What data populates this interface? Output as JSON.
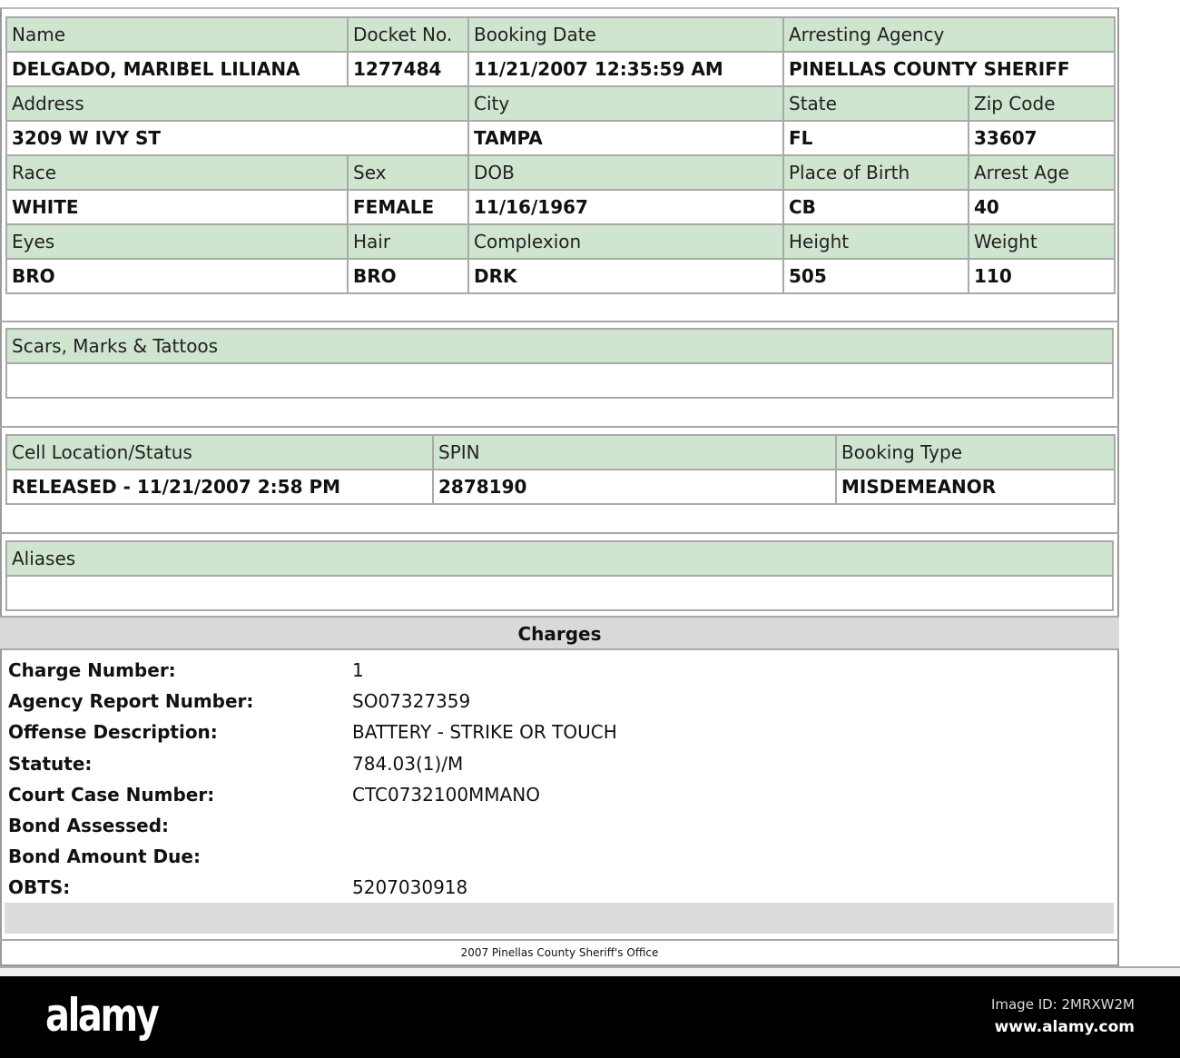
{
  "booking": {
    "rows": [
      {
        "headers": [
          "Name",
          "Docket No.",
          "Booking Date",
          "Arresting Agency"
        ],
        "values": [
          "DELGADO, MARIBEL LILIANA",
          "1277484",
          "11/21/2007 12:35:59 AM",
          "PINELLAS COUNTY SHERIFF"
        ]
      },
      {
        "headers": [
          "Address",
          "City",
          "State",
          "Zip Code"
        ],
        "values": [
          "3209 W IVY ST",
          "TAMPA",
          "FL",
          "33607"
        ]
      },
      {
        "headers": [
          "Race",
          "Sex",
          "DOB",
          "Place of Birth",
          "Arrest Age"
        ],
        "values": [
          "WHITE",
          "FEMALE",
          "11/16/1967",
          "CB",
          "40"
        ]
      },
      {
        "headers": [
          "Eyes",
          "Hair",
          "Complexion",
          "Height",
          "Weight"
        ],
        "values": [
          "BRO",
          "BRO",
          "DRK",
          "505",
          "110"
        ]
      }
    ]
  },
  "scars": {
    "header": "Scars, Marks & Tattoos",
    "value": ""
  },
  "cell": {
    "headers": [
      "Cell Location/Status",
      "SPIN",
      "Booking Type"
    ],
    "values": [
      "RELEASED - 11/21/2007 2:58 PM",
      "2878190",
      "MISDEMEANOR"
    ]
  },
  "aliases": {
    "header": "Aliases",
    "value": ""
  },
  "charges": {
    "title": "Charges",
    "items": [
      {
        "label": "Charge Number:",
        "value": "1"
      },
      {
        "label": "Agency Report Number:",
        "value": "SO07327359"
      },
      {
        "label": "Offense Description:",
        "value": "BATTERY - STRIKE OR TOUCH"
      },
      {
        "label": "Statute:",
        "value": "784.03(1)/M"
      },
      {
        "label": "Court Case Number:",
        "value": "CTC0732100MMANO"
      },
      {
        "label": "Bond Assessed:",
        "value": ""
      },
      {
        "label": "Bond Amount Due:",
        "value": ""
      },
      {
        "label": "OBTS:",
        "value": "5207030918"
      }
    ]
  },
  "footer": "2007 Pinellas County Sheriff's Office",
  "watermark": {
    "logo": "alamy",
    "image_id": "Image ID: 2MRXW2M",
    "url": "www.alamy.com"
  }
}
